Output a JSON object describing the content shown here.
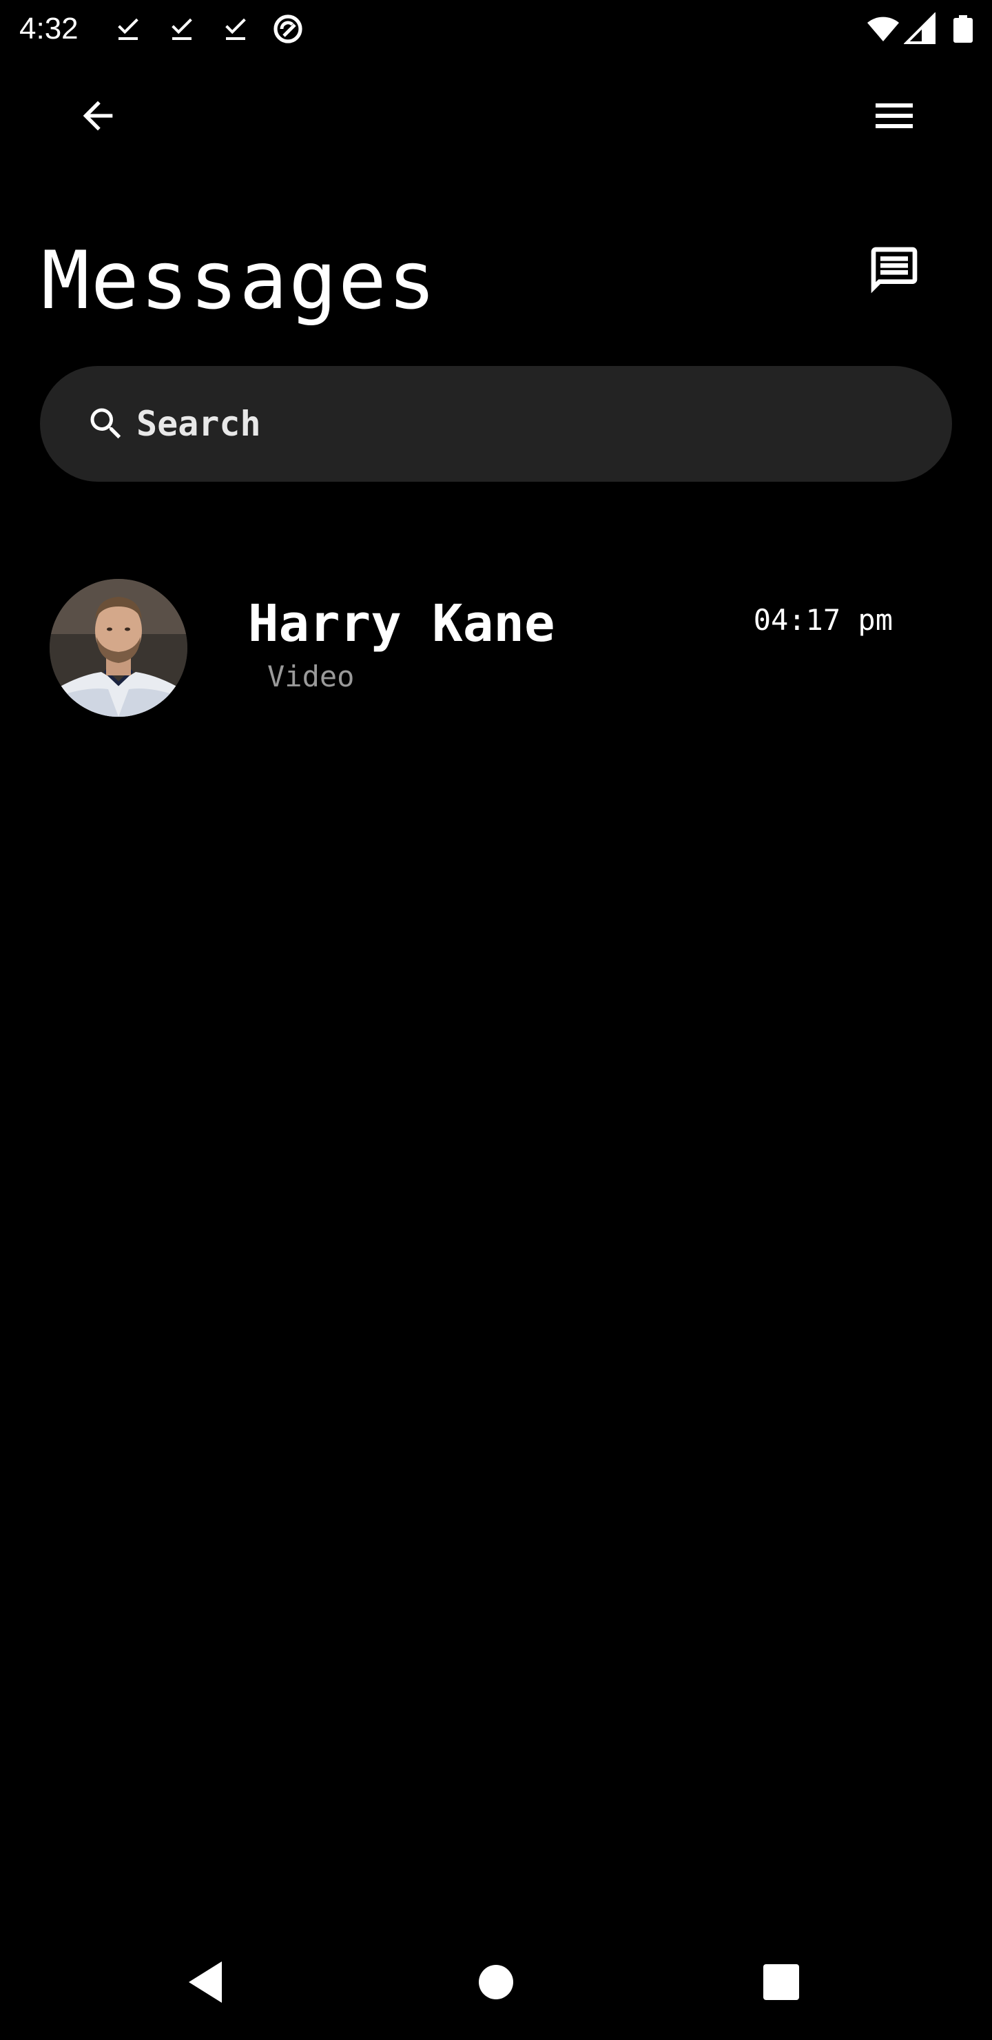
{
  "status_bar": {
    "time": "4:32",
    "icons": [
      "download-done-icon",
      "download-done-icon",
      "download-done-icon",
      "data-saver-icon",
      "wifi-icon",
      "signal-icon",
      "battery-icon"
    ]
  },
  "app_bar": {
    "back_icon": "arrow-back-icon",
    "menu_icon": "hamburger-menu-icon"
  },
  "page": {
    "title": "Messages",
    "compose_icon": "chat-icon"
  },
  "search": {
    "placeholder": "Search",
    "icon": "search-icon"
  },
  "conversations": [
    {
      "name": "Harry Kane",
      "last_message": "Video",
      "time": "04:17 pm",
      "avatar": "avatar-photo"
    }
  ],
  "nav_bar": {
    "icons": [
      "back-triangle-icon",
      "home-circle-icon",
      "recents-square-icon"
    ]
  },
  "colors": {
    "background": "#000000",
    "search_background": "#232323",
    "primary_text": "#ffffff",
    "secondary_text": "#9a9a9a"
  }
}
